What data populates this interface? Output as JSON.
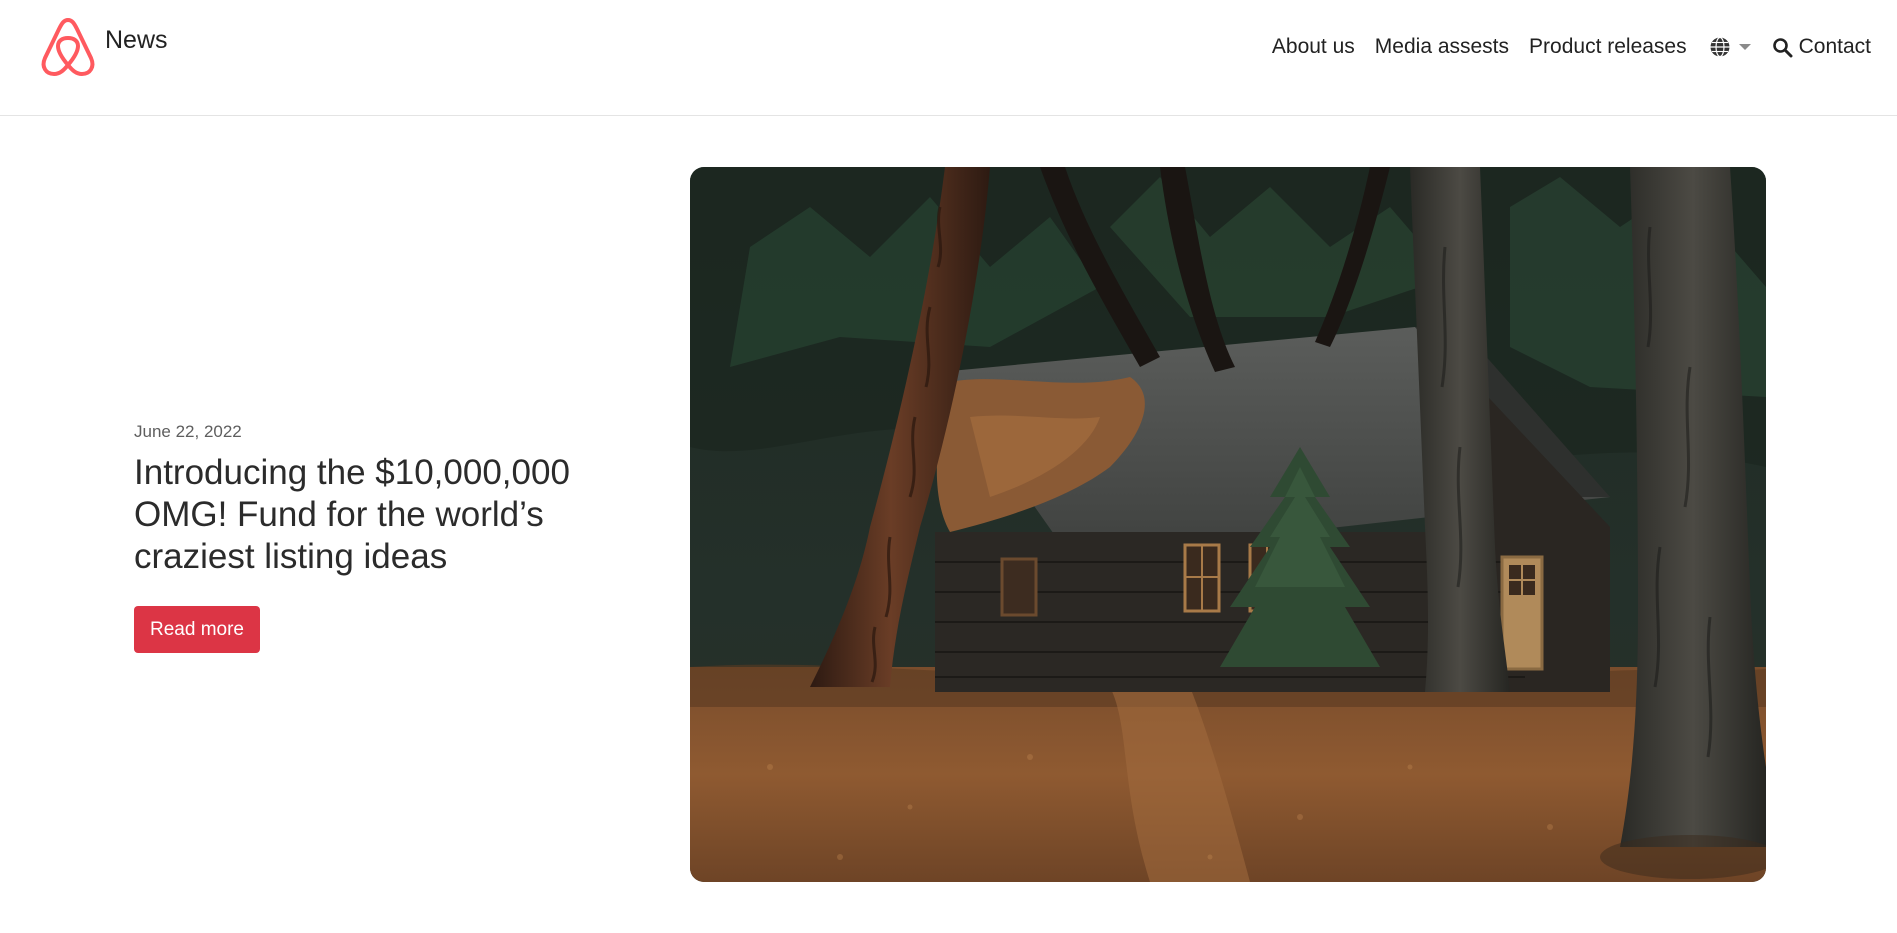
{
  "header": {
    "brand_text": "News",
    "logo_icon": "airbnb-logo-icon",
    "nav": [
      {
        "label": "About us"
      },
      {
        "label": "Media assests"
      },
      {
        "label": "Product releases"
      }
    ],
    "language_icon": "globe-icon",
    "contact_label": "Contact",
    "contact_icon": "search-icon"
  },
  "featured": {
    "date": "June 22, 2022",
    "title": "Introducing the $10,000,000 OMG! Fund for the world’s craziest listing ideas",
    "button_label": "Read more",
    "image_icon": "cabin-in-forest-photo"
  },
  "colors": {
    "brand": "#ff5a5f",
    "button": "#dc3545",
    "text": "#222222"
  }
}
